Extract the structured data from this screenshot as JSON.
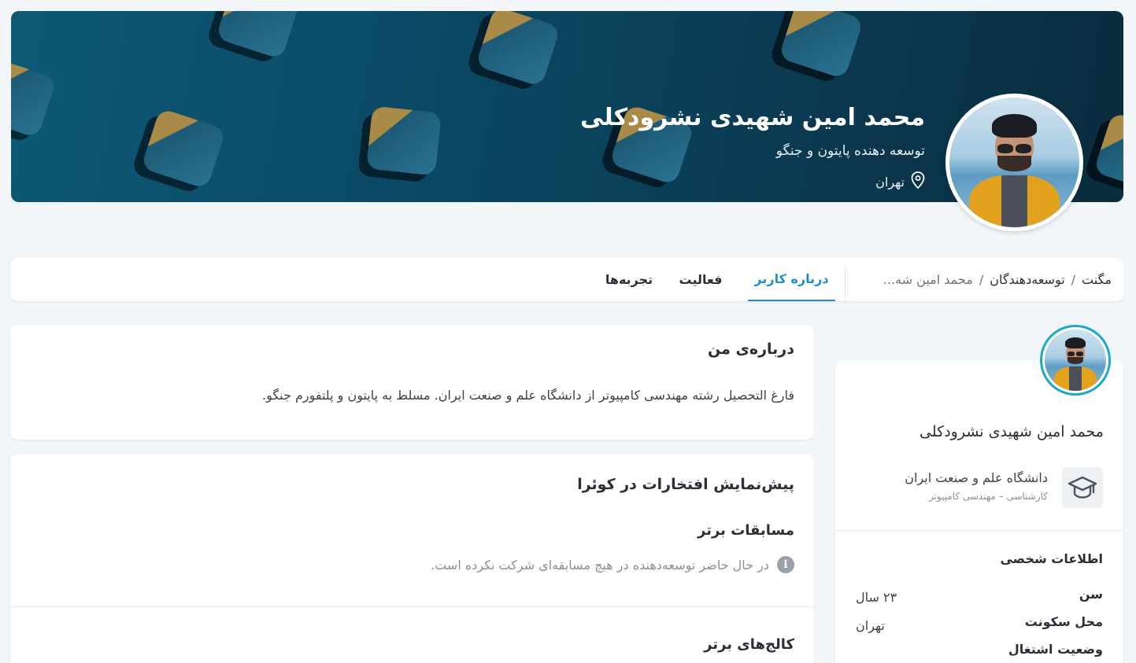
{
  "profile": {
    "name": "محمد امین شهیدی نشرودکلی",
    "role": "توسعه دهنده پایتون و جنگو",
    "location": "تهران"
  },
  "breadcrumb": {
    "items": [
      "مگنت",
      "توسعه‌دهندگان",
      "محمد امین شه..."
    ],
    "separator": "/"
  },
  "tabs": [
    {
      "label": "درباره کاربر",
      "active": true
    },
    {
      "label": "فعالیت",
      "active": false
    },
    {
      "label": "تجربه‌ها",
      "active": false
    }
  ],
  "about": {
    "title": "درباره‌ی من",
    "text": "فارغ التحصیل رشته مهندسی کامپیوتر از دانشگاه علم و صنعت ایران. مسلط به پایتون و پلتفورم جنگو."
  },
  "achievements": {
    "title": "پیش‌نمایش افتخارات در کوئرا",
    "competitions_title": "مسابقات برتر",
    "competitions_empty": "در حال حاضر توسعه‌دهنده در هیچ مسابقه‌ای شرکت نکرده است.",
    "colleges_title": "کالج‌های برتر"
  },
  "sidebar": {
    "name": "محمد امین شهیدی نشرودکلی",
    "education": {
      "school": "دانشگاه علم و صنعت ایران",
      "degree": "کارشناسی – مهندسی کامپیوتر"
    },
    "personal_info_title": "اطلاعات شخصی",
    "fields": [
      {
        "key": "سن",
        "value": "۲۳ سال"
      },
      {
        "key": "محل سکونت",
        "value": "تهران"
      },
      {
        "key": "وضعیت اشتغال",
        "value": ""
      }
    ]
  },
  "colors": {
    "accent": "#1b8fd0",
    "avatar_ring": "#1ba9c9",
    "hero_dark": "#0a2c3e",
    "hero_light": "#0c5a76"
  }
}
